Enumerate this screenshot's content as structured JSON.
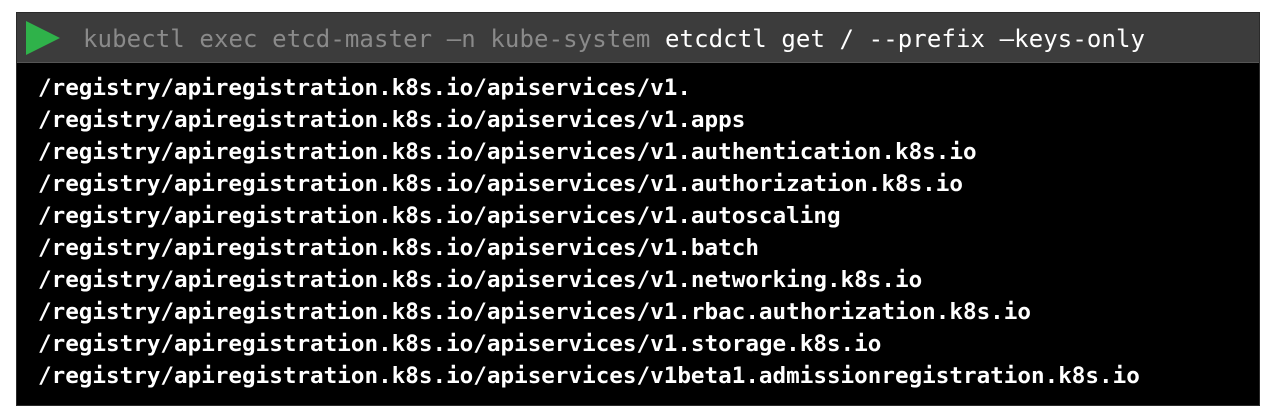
{
  "terminal": {
    "command": {
      "prefix": "kubectl exec etcd-master –n kube-system ",
      "main": "etcdctl get / --prefix –keys-only"
    },
    "output_lines": [
      "/registry/apiregistration.k8s.io/apiservices/v1.",
      "/registry/apiregistration.k8s.io/apiservices/v1.apps",
      "/registry/apiregistration.k8s.io/apiservices/v1.authentication.k8s.io",
      "/registry/apiregistration.k8s.io/apiservices/v1.authorization.k8s.io",
      "/registry/apiregistration.k8s.io/apiservices/v1.autoscaling",
      "/registry/apiregistration.k8s.io/apiservices/v1.batch",
      "/registry/apiregistration.k8s.io/apiservices/v1.networking.k8s.io",
      "/registry/apiregistration.k8s.io/apiservices/v1.rbac.authorization.k8s.io",
      "/registry/apiregistration.k8s.io/apiservices/v1.storage.k8s.io",
      "/registry/apiregistration.k8s.io/apiservices/v1beta1.admissionregistration.k8s.io"
    ],
    "icons": {
      "run": "play-icon"
    },
    "colors": {
      "play_icon": "#2fb24a",
      "background": "#000000",
      "command_bar": "#3c3c3c",
      "command_dim": "#8a8a8a",
      "text": "#ffffff"
    }
  }
}
